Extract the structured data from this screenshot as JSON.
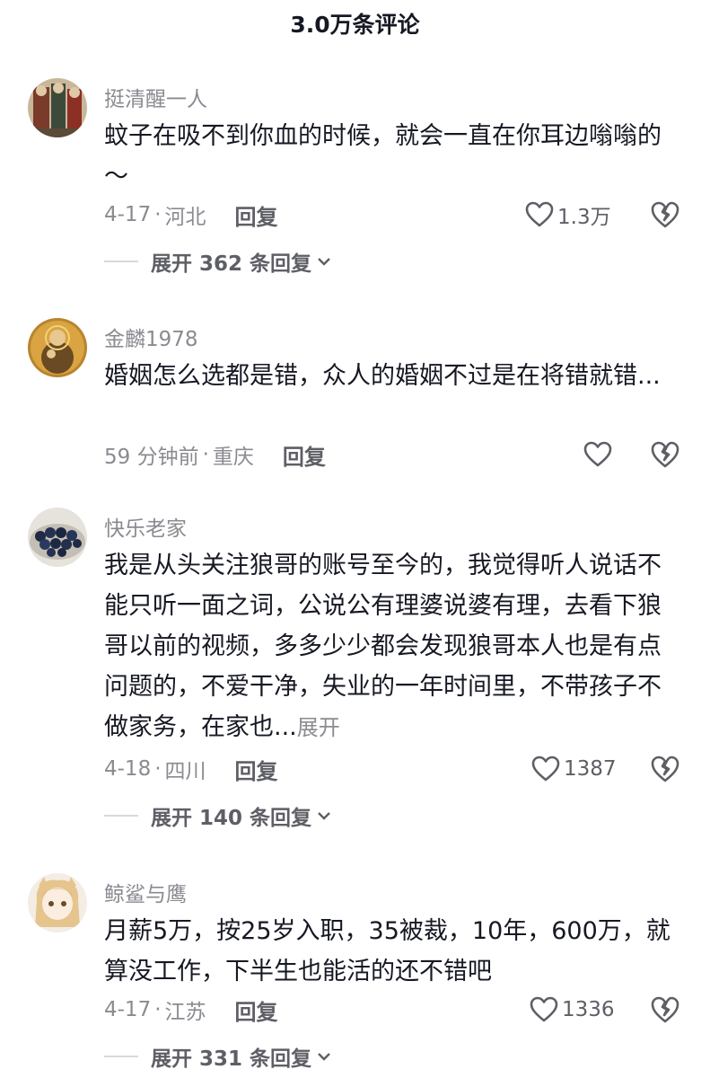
{
  "header": {
    "title": "3.0万条评论"
  },
  "comments": [
    {
      "avatar": "avatar-icon",
      "user": "挺清醒一人",
      "text": "蚊子在吸不到你血的时候，就会一直在你耳边嗡嗡的～",
      "expand": "",
      "time": "4-17",
      "location": "河北",
      "reply": "回复",
      "likes": "1.3万",
      "more_replies": "展开 362 条回复"
    },
    {
      "avatar": "avatar-icon",
      "user": "金麟1978",
      "text": "婚姻怎么选都是错，众人的婚姻不过是在将错就错...",
      "expand": "",
      "time": "59 分钟前",
      "location": "重庆",
      "reply": "回复",
      "likes": "",
      "more_replies": ""
    },
    {
      "avatar": "avatar-icon",
      "user": "快乐老家",
      "text": "我是从头关注狼哥的账号至今的，我觉得听人说话不能只听一面之词，公说公有理婆说婆有理，去看下狼哥以前的视频，多多少少都会发现狼哥本人也是有点问题的，不爱干净，失业的一年时间里，不带孩子不做家务，在家也...",
      "expand": "展开",
      "time": "4-18",
      "location": "四川",
      "reply": "回复",
      "likes": "1387",
      "more_replies": "展开 140 条回复"
    },
    {
      "avatar": "avatar-icon",
      "user": "鲸鲨与鹰",
      "text": "月薪5万，按25岁入职，35被裁，10年，600万，就算没工作，下半生也能活的还不错吧",
      "expand": "",
      "time": "4-17",
      "location": "江苏",
      "reply": "回复",
      "likes": "1336",
      "more_replies": "展开 331 条回复"
    }
  ],
  "icons": {
    "like": "heart-outline-icon",
    "dislike": "broken-heart-icon",
    "chevron": "chevron-down-icon"
  },
  "colors": {
    "text": "#161823",
    "secondary": "#8a8b91",
    "action": "#5e5f66"
  }
}
